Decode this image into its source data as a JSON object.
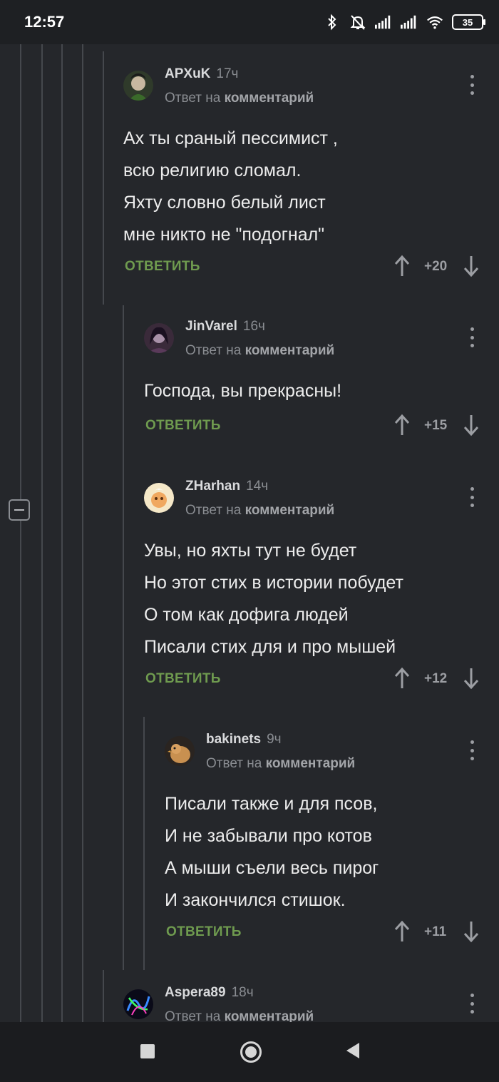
{
  "status_bar": {
    "time": "12:57",
    "icons": [
      "bluetooth-icon",
      "bell-muted-icon",
      "signal-icon",
      "signal-icon",
      "wifi-icon"
    ],
    "battery": "35"
  },
  "comments": [
    {
      "author": "APXuK",
      "time": "17ч",
      "reply_prefix": "Ответ на",
      "reply_target": "комментарий",
      "lines": [
        "Ах ты сраный пессимист ,",
        "всю религию сломал.",
        "Яхту словно белый лист",
        "мне никто не \"подогнал\""
      ],
      "reply_label": "ОТВЕТИТЬ",
      "score": "+20"
    },
    {
      "author": "JinVarel",
      "time": "16ч",
      "reply_prefix": "Ответ на",
      "reply_target": "комментарий",
      "lines": [
        "Господа, вы прекрасны!"
      ],
      "reply_label": "ОТВЕТИТЬ",
      "score": "+15"
    },
    {
      "author": "ZHarhan",
      "time": "14ч",
      "reply_prefix": "Ответ на",
      "reply_target": "комментарий",
      "lines": [
        "Увы, но яхты тут не будет",
        "Но этот стих в истории побудет",
        "О том как дофига людей",
        "Писали стих для и про мышей"
      ],
      "reply_label": "ОТВЕТИТЬ",
      "score": "+12"
    },
    {
      "author": "bakinets",
      "time": "9ч",
      "reply_prefix": "Ответ на",
      "reply_target": "комментарий",
      "lines": [
        "Писали также и для псов,",
        "И не забывали про котов",
        "А мыши съели весь пирог",
        "И закончился стишок."
      ],
      "reply_label": "ОТВЕТИТЬ",
      "score": "+11"
    },
    {
      "author": "Aspera89",
      "time": "18ч",
      "reply_prefix": "Ответ на",
      "reply_target": "комментарий"
    }
  ],
  "colors": {
    "background": "#25272b",
    "reply_green": "#6f9b4f",
    "muted_text": "#8a8d92"
  }
}
